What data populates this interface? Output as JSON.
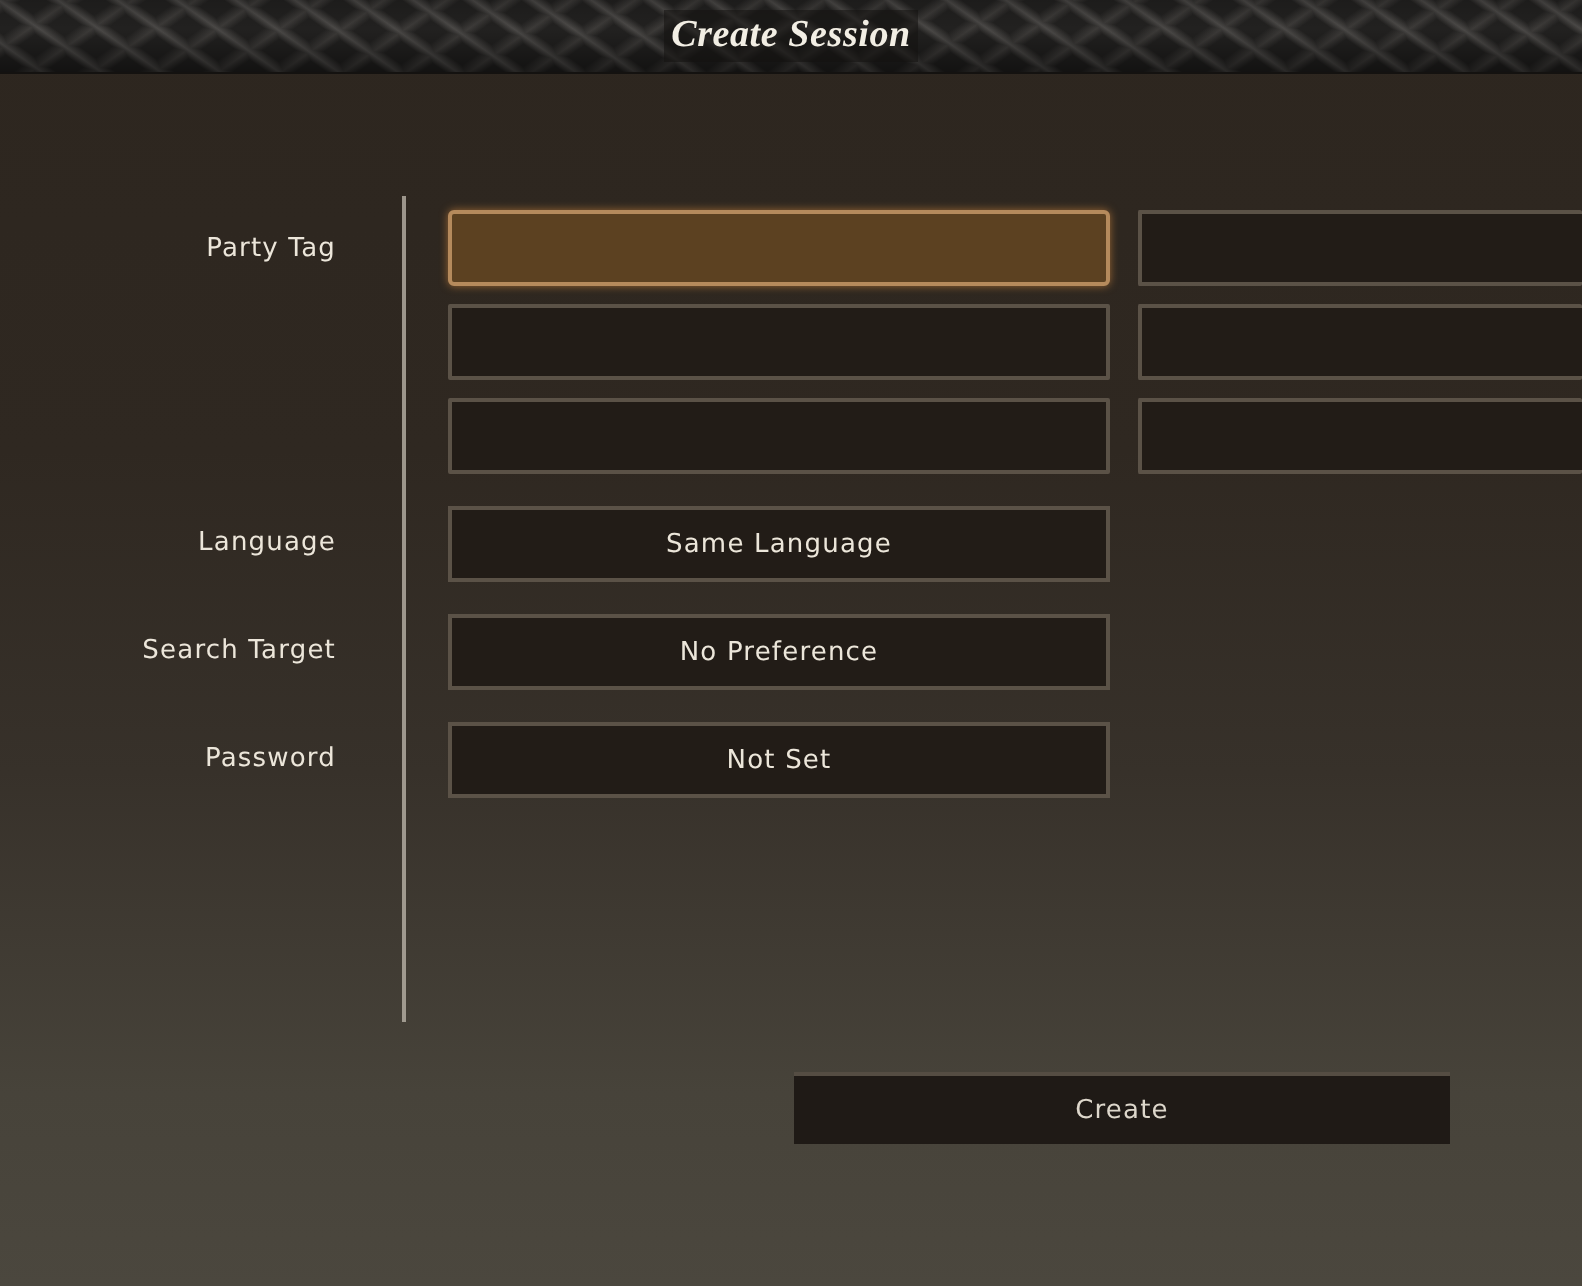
{
  "window": {
    "title": "Create Session"
  },
  "form": {
    "fields": [
      {
        "kind": "slots",
        "label": "Party Tag",
        "slots": [
          {
            "selected": true
          },
          {
            "selected": false
          },
          {
            "selected": false
          },
          {
            "selected": false
          },
          {
            "selected": false
          },
          {
            "selected": false
          }
        ]
      },
      {
        "kind": "option",
        "label": "Language",
        "value": "Same Language",
        "selected": false
      },
      {
        "kind": "option",
        "label": "Search Target",
        "value": "No Preference",
        "selected": false
      },
      {
        "kind": "option",
        "label": "Password",
        "value": "Not Set",
        "selected": false
      }
    ]
  },
  "buttons": [
    {
      "label": "Create",
      "selected": false
    }
  ]
}
